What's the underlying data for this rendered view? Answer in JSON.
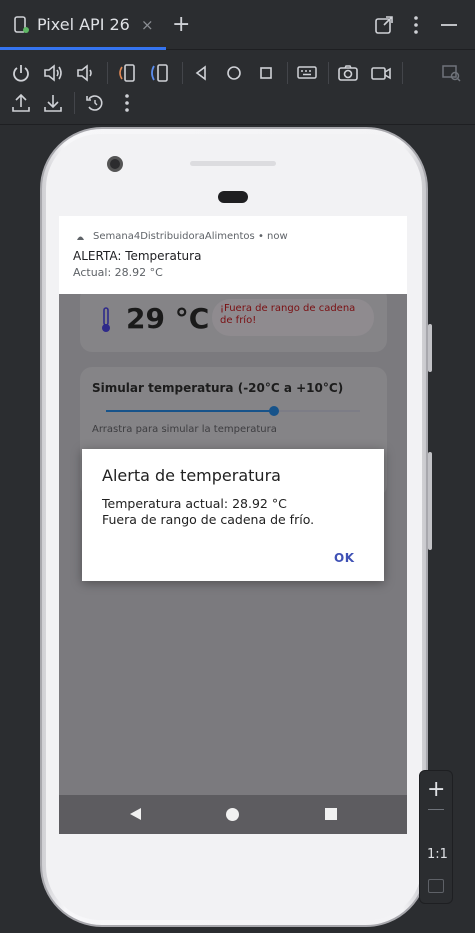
{
  "tab": {
    "title": "Pixel API 26",
    "close": "×",
    "add": "+"
  },
  "toolbar_icons": [
    "power-icon",
    "volume-up-icon",
    "volume-down-icon",
    "rotate-left-icon",
    "rotate-right-icon",
    "back-icon",
    "home-icon",
    "overview-icon",
    "keyboard-icon",
    "camera-icon",
    "record-icon",
    "snapshot-icon",
    "upload-icon",
    "download-icon",
    "reset-icon",
    "more-icon"
  ],
  "app": {
    "temperature_display": "29 °C",
    "warning": "¡Fuera de rango de cadena de frío!",
    "simulate_title": "Simular temperatura (-20°C a +10°C)",
    "slider_fraction": 0.66,
    "simulate_hint": "Arrastra para simular la temperatura"
  },
  "notification": {
    "app_name": "Semana4DistribuidoraAlimentos",
    "time": "now",
    "separator": "•",
    "title": "ALERTA: Temperatura",
    "text": "Actual: 28.92 °C"
  },
  "dialog": {
    "title": "Alerta de temperatura",
    "line1": "Temperatura actual: 28.92 °C",
    "line2": "Fuera de rango de cadena de frío.",
    "ok": "OK"
  },
  "zoom": {
    "plus": "+",
    "one_to_one": "1:1"
  },
  "colors": {
    "accent": "#3574f0",
    "dialog_button": "#3f51b5",
    "warning_text": "#7a0f12",
    "slider": "#17538a"
  }
}
